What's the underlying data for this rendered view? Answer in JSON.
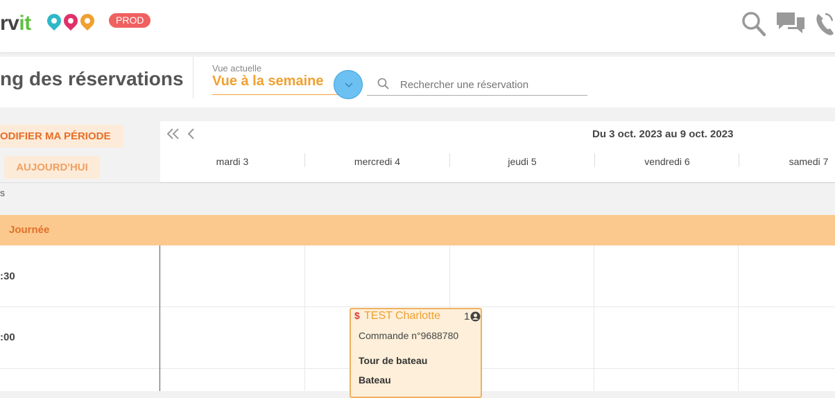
{
  "app": {
    "logo_text_dark": "rv",
    "logo_text_green": "it",
    "env_badge": "PROD",
    "icons": [
      "search-icon",
      "chat-icon",
      "phone-icon"
    ]
  },
  "header": {
    "title": "ng des réservations",
    "view_label": "Vue actuelle",
    "view_value": "Vue à la semaine",
    "search_placeholder": "Rechercher une réservation"
  },
  "sidebar": {
    "modify_button": "ODIFIER MA PÉRIODE",
    "today_button": "AUJOURD'HUI",
    "section_letter": "s"
  },
  "calendar": {
    "range": "Du 3 oct. 2023 au 9 oct. 2023",
    "days": [
      "mardi 3",
      "mercredi 4",
      "jeudi 5",
      "vendredi 6",
      "samedi 7"
    ],
    "all_day_label": "Journée",
    "time_slots": [
      ":30",
      ":00"
    ]
  },
  "event": {
    "currency": "$",
    "name": "TEST Charlotte",
    "count": "1",
    "order": "Commande n°9688780",
    "activity": "Tour de bateau",
    "resource": "Bateau"
  },
  "colors": {
    "accent_orange": "#f0a030",
    "band_orange": "#fbc98e",
    "prod_red": "#f06060",
    "highlight_blue": "#6cc1f2"
  }
}
